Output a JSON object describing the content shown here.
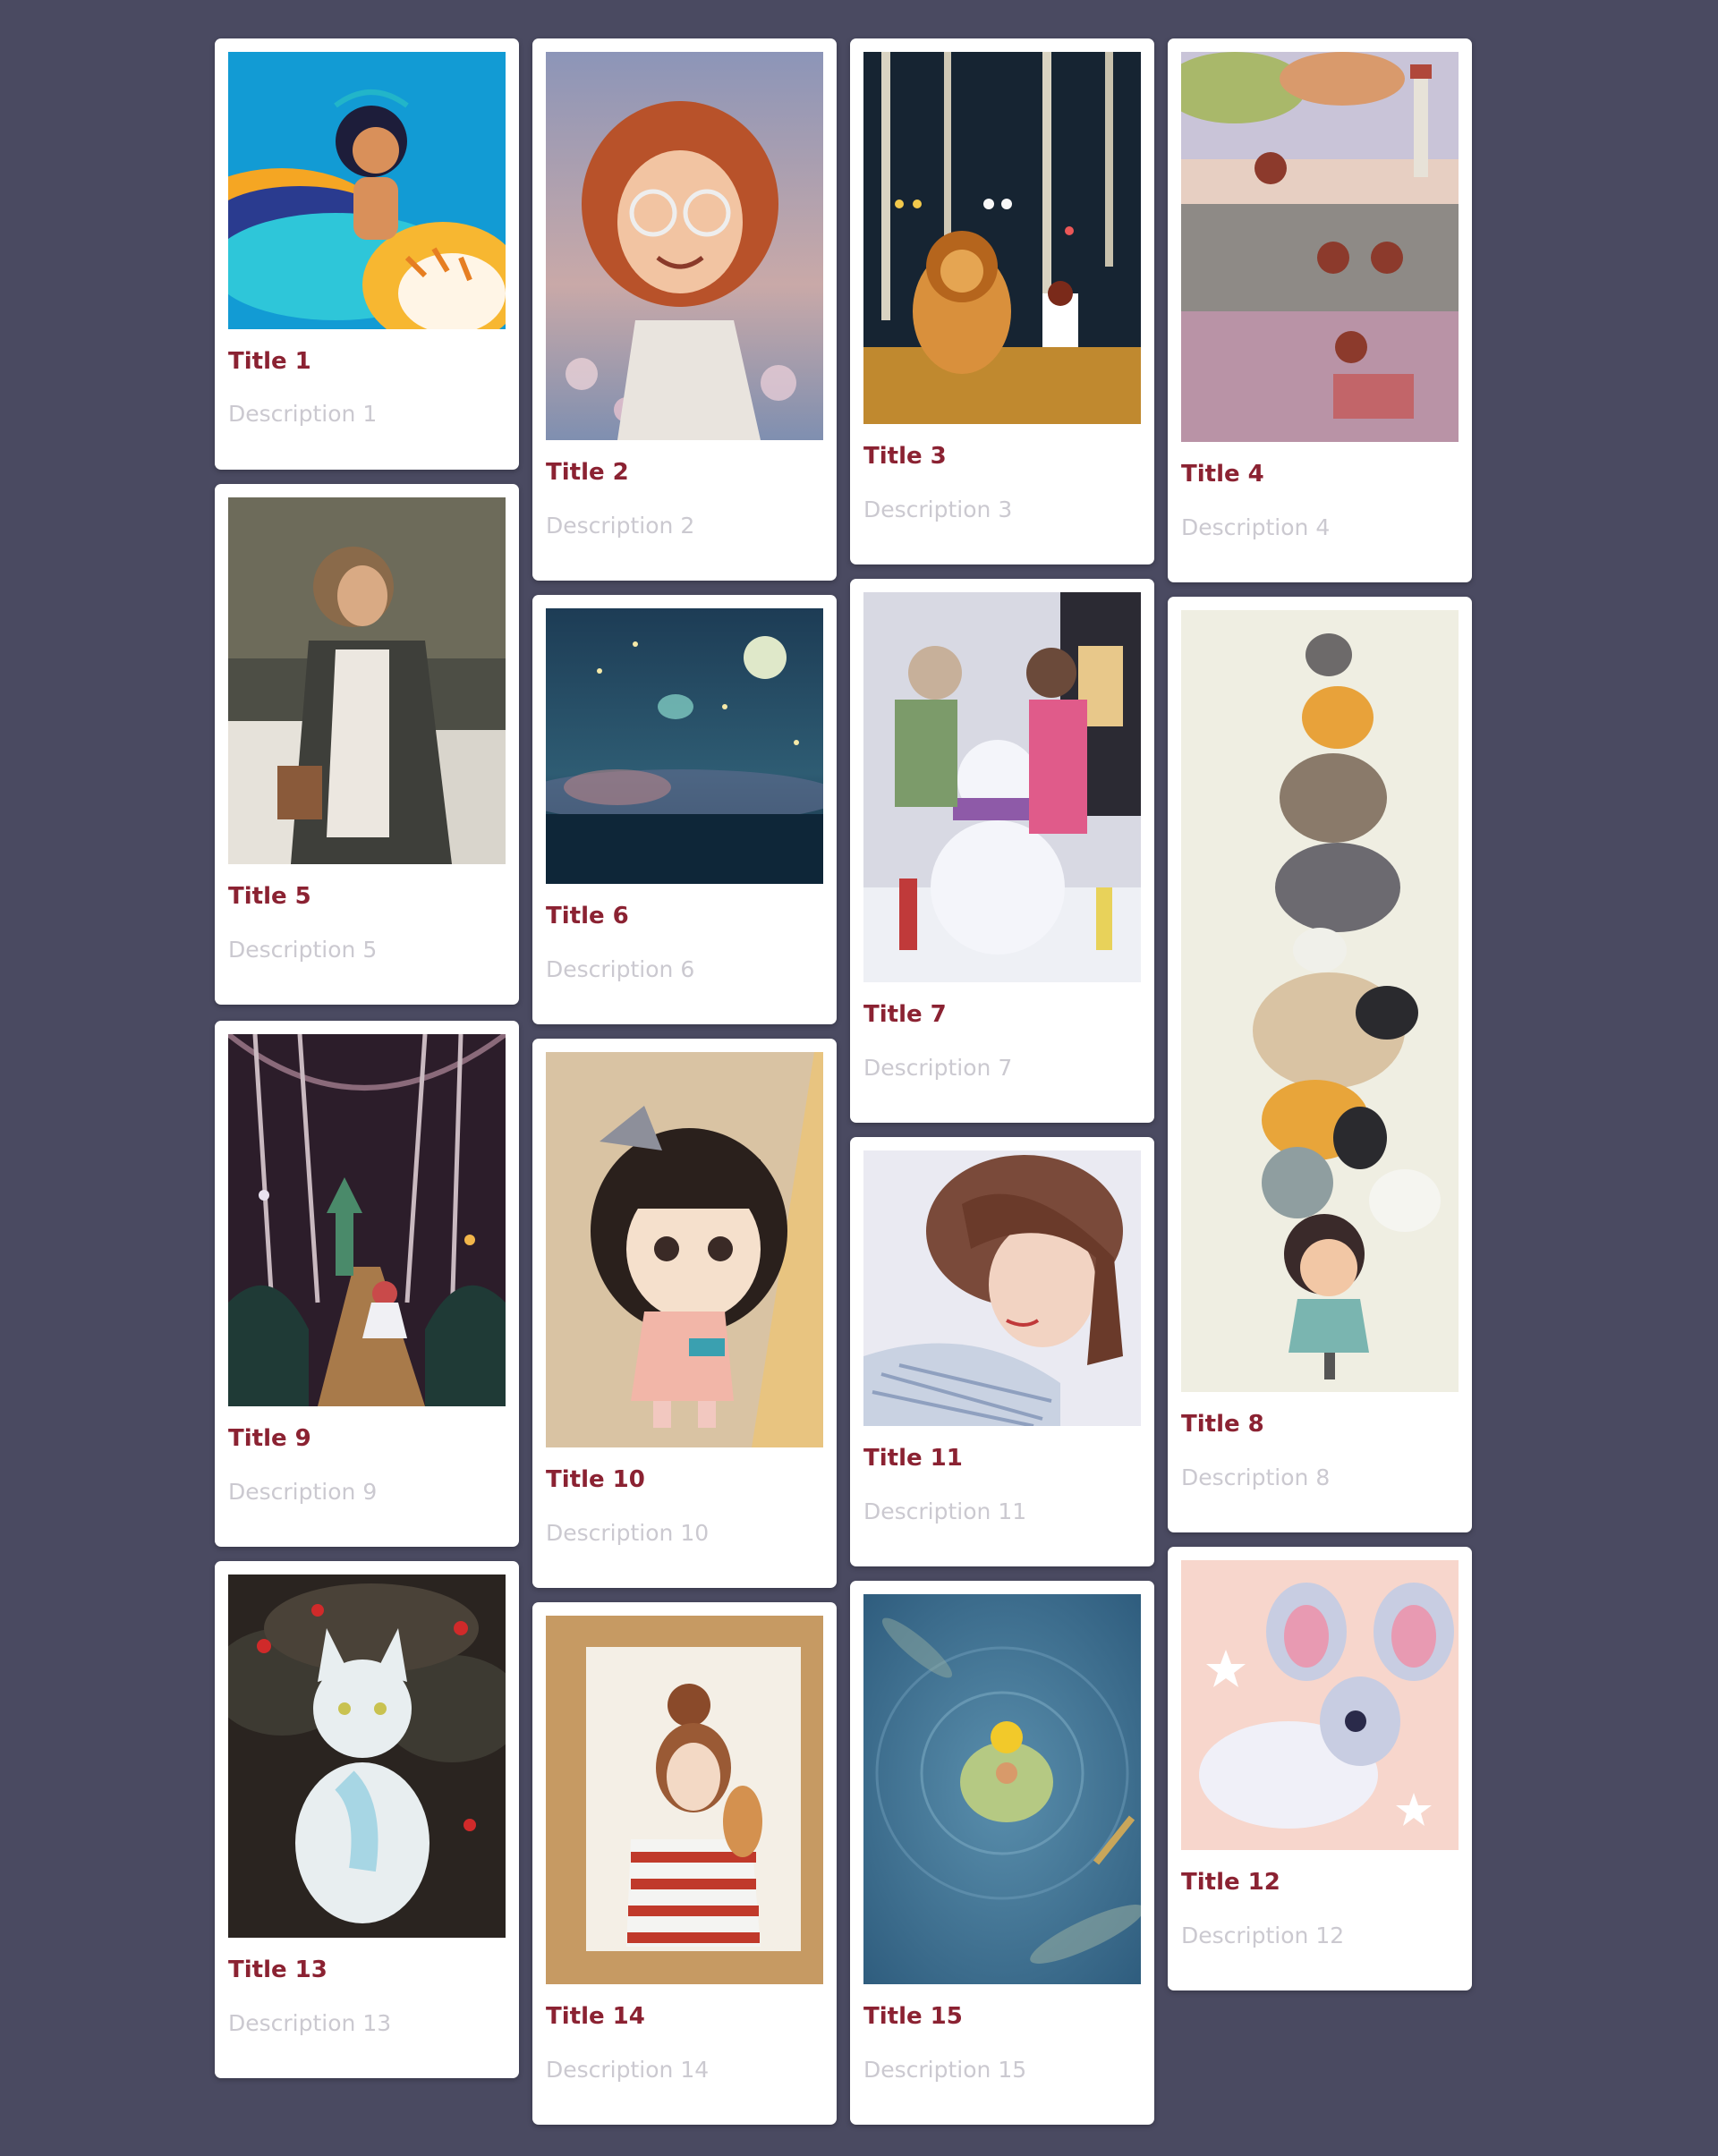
{
  "cards": [
    {
      "title": "Title 1",
      "description": "Description 1",
      "image": "princess-with-tiger-illustration"
    },
    {
      "title": "Title 2",
      "description": "Description 2",
      "image": "red-haired-girl-with-glasses-illustration"
    },
    {
      "title": "Title 3",
      "description": "Description 3",
      "image": "lion-in-night-forest-illustration"
    },
    {
      "title": "Title 4",
      "description": "Description 4",
      "image": "girls-picnic-by-lighthouse-illustration"
    },
    {
      "title": "Title 5",
      "description": "Description 5",
      "image": "girl-with-bucket-painting"
    },
    {
      "title": "Title 6",
      "description": "Description 6",
      "image": "night-sky-with-moon-illustration"
    },
    {
      "title": "Title 7",
      "description": "Description 7",
      "image": "girls-with-snowman-illustration"
    },
    {
      "title": "Title 8",
      "description": "Description 8",
      "image": "stack-of-cats-on-girl-illustration"
    },
    {
      "title": "Title 9",
      "description": "Description 9",
      "image": "forest-path-with-witch-illustration"
    },
    {
      "title": "Title 10",
      "description": "Description 10",
      "image": "chibi-girl-with-bow-illustration"
    },
    {
      "title": "Title 11",
      "description": "Description 11",
      "image": "woman-portrait-illustration"
    },
    {
      "title": "Title 12",
      "description": "Description 12",
      "image": "white-fox-creature-illustration"
    },
    {
      "title": "Title 13",
      "description": "Description 13",
      "image": "white-cat-in-red-flowers-illustration"
    },
    {
      "title": "Title 14",
      "description": "Description 14",
      "image": "watercolor-girl-with-cat-illustration"
    },
    {
      "title": "Title 15",
      "description": "Description 15",
      "image": "child-on-lily-pad-illustration"
    }
  ]
}
